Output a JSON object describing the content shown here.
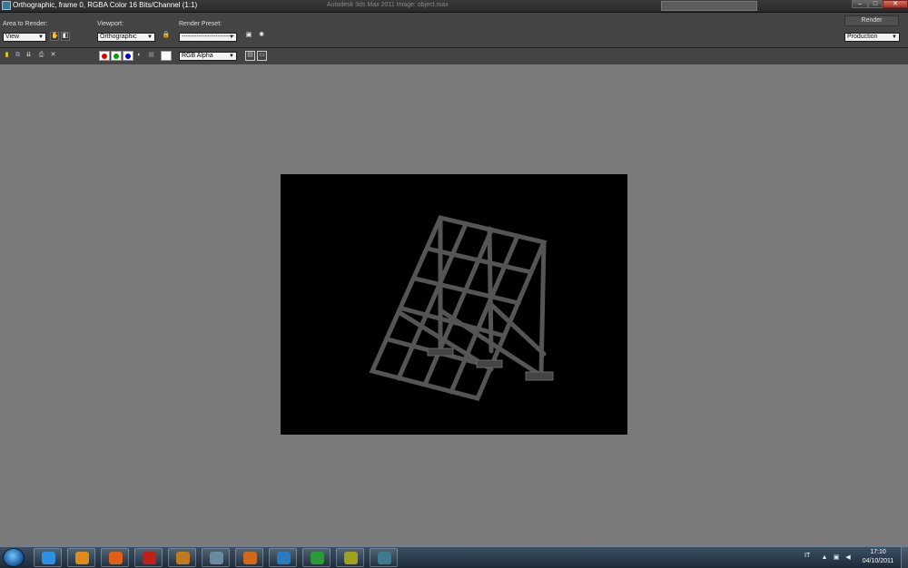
{
  "window": {
    "title": "Orthographic, frame 0, RGBA Color 16 Bits/Channel (1:1)",
    "background_title": "Autodesk 3ds Max  2011      Image: object.max",
    "controls": {
      "minimize": "–",
      "maximize": "□",
      "close": "✕"
    }
  },
  "panel": {
    "area_to_render_label": "Area to Render:",
    "area_to_render_value": "View",
    "viewport_label": "Viewport:",
    "viewport_value": "Orthographic",
    "render_preset_label": "Render Preset:",
    "render_preset_value": "-------------------------",
    "render_button": "Render",
    "production_value": "Production"
  },
  "toolbar2": {
    "channel_value": "RGB Alpha",
    "channels": [
      {
        "name": "red-channel-toggle",
        "color": "#e00000"
      },
      {
        "name": "green-channel-toggle",
        "color": "#00a000"
      },
      {
        "name": "blue-channel-toggle",
        "color": "#0000d0"
      }
    ]
  },
  "render": {
    "background": "#000000",
    "structure_color": "#5a5a5a"
  },
  "taskbar": {
    "items": [
      {
        "name": "internet-explorer-icon",
        "color": "#2f8fe0"
      },
      {
        "name": "media-player-icon",
        "color": "#e08a1a"
      },
      {
        "name": "firefox-icon",
        "color": "#e0601a"
      },
      {
        "name": "filezilla-icon",
        "color": "#c0201a"
      },
      {
        "name": "3ds-max-icon",
        "color": "#c07a20"
      },
      {
        "name": "app-icon",
        "color": "#6a8aa0"
      },
      {
        "name": "tools-icon",
        "color": "#d06a1a"
      },
      {
        "name": "sketchup-icon",
        "color": "#2a7ac0"
      },
      {
        "name": "utorrent-icon",
        "color": "#2a9a3a"
      },
      {
        "name": "computer-icon",
        "color": "#a0a020"
      },
      {
        "name": "3ds-max-window-icon",
        "color": "#3d7a8f"
      }
    ],
    "language": "IT",
    "time": "17:10",
    "date": "04/10/2011"
  }
}
